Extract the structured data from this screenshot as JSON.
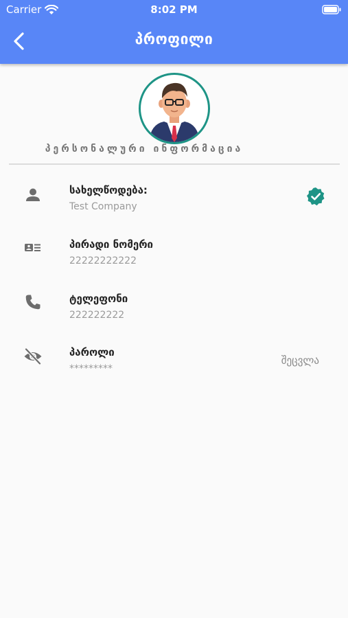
{
  "status_bar": {
    "carrier": "Carrier",
    "time": "8:02 PM"
  },
  "app_bar": {
    "title": "პროფილი"
  },
  "section": {
    "title": "პერსონალური ინფორმაცია"
  },
  "fields": [
    {
      "label": "სახელწოდება:",
      "value": "Test Company",
      "icon": "person-icon",
      "verified": true
    },
    {
      "label": "პირადი ნომერი",
      "value": "22222222222",
      "icon": "id-card-icon"
    },
    {
      "label": "ტელეფონი",
      "value": "222222222",
      "icon": "phone-icon"
    },
    {
      "label": "პაროლი",
      "value": "*********",
      "icon": "eye-off-icon",
      "action": "შეცვლა"
    }
  ],
  "colors": {
    "app_bar": "#5886f7",
    "accent": "#1e9486",
    "icon": "#6d6d6d"
  }
}
